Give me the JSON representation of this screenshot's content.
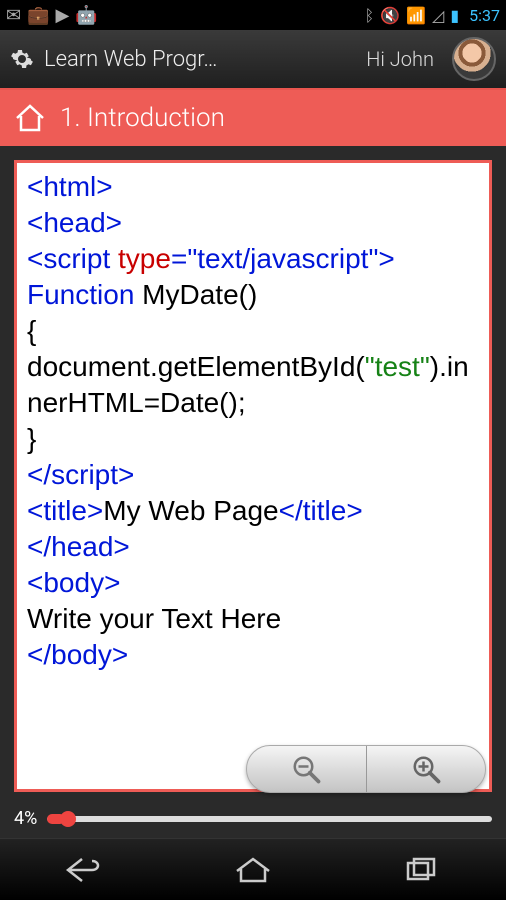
{
  "status": {
    "time": "5:37"
  },
  "header": {
    "title": "Learn Web Progr…",
    "greeting": "Hi John"
  },
  "section": {
    "title": "1. Introduction"
  },
  "code": {
    "l1_a": "<html>",
    "l2_a": "<head>",
    "l3_a": "<script ",
    "l3_b": "type",
    "l3_c": "=",
    "l3_d": "\"text/javascript\"",
    "l3_e": ">",
    "l4_a": "Function",
    "l4_b": " MyDate()",
    "l5_a": "{",
    "l6_a": "document.getElementById(",
    "l6_b": "\"test\"",
    "l6_c": ").innerHTML=Date();",
    "l7_a": "}",
    "l8_a": "</script>",
    "l9_a": "<title>",
    "l9_b": "My Web Page",
    "l9_c": "</title>",
    "l10_a": "</head>",
    "l11_a": "<body>",
    "l12_a": "Write your Text Here",
    "l13_a": "</body>"
  },
  "progress": {
    "label": "4%"
  },
  "colors": {
    "accent": "#ee5c56",
    "link_blue": "#3cc3ff"
  }
}
